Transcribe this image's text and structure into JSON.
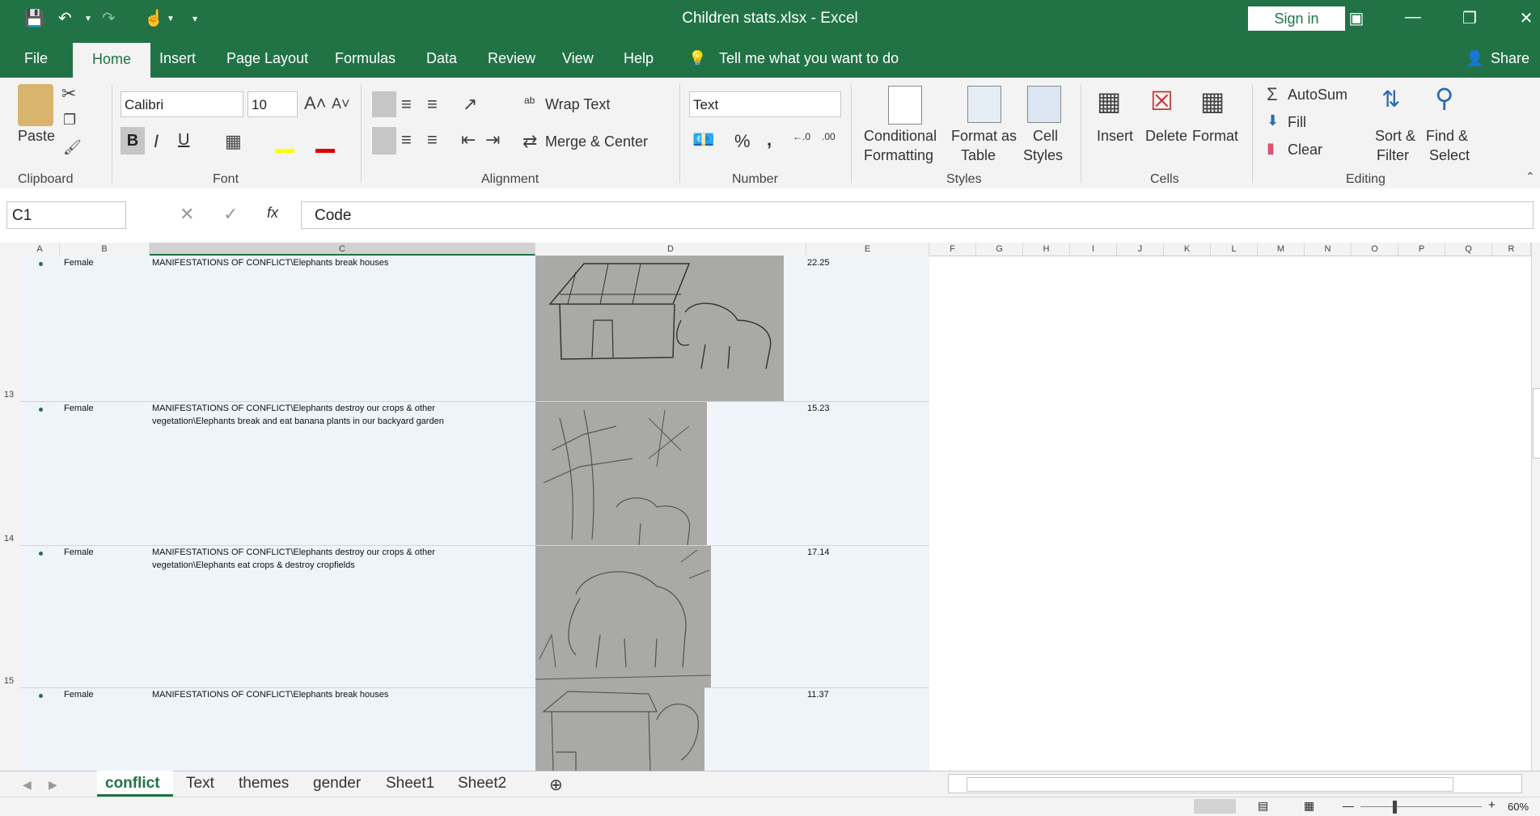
{
  "window": {
    "title": "Children stats.xlsx  -  Excel",
    "sign_in": "Sign in"
  },
  "tabs": [
    "File",
    "Home",
    "Insert",
    "Page Layout",
    "Formulas",
    "Data",
    "Review",
    "View",
    "Help"
  ],
  "tell_me": "Tell me what you want to do",
  "share": "Share",
  "ribbon": {
    "clipboard": {
      "paste": "Paste",
      "label": "Clipboard"
    },
    "font": {
      "name": "Calibri",
      "size": "10",
      "bold": "B",
      "italic": "I",
      "underline": "U",
      "label": "Font"
    },
    "alignment": {
      "wrap_text": "Wrap Text",
      "merge_center": "Merge & Center",
      "label": "Alignment"
    },
    "number": {
      "format": "Text",
      "percent": "%",
      "comma": ",",
      "label": "Number"
    },
    "styles": {
      "conditional": "Conditional",
      "formatting": "Formatting",
      "format_as": "Format as",
      "table": "Table",
      "cell": "Cell",
      "styles_word": "Styles",
      "label": "Styles"
    },
    "cells": {
      "insert": "Insert",
      "delete": "Delete",
      "format": "Format",
      "label": "Cells"
    },
    "editing": {
      "autosum": "AutoSum",
      "fill": "Fill",
      "clear": "Clear",
      "sort": "Sort &",
      "filter": "Filter",
      "find": "Find &",
      "select": "Select",
      "label": "Editing"
    }
  },
  "formula_bar": {
    "name_box": "C1",
    "content": "Code",
    "fx": "fx"
  },
  "columns": [
    "A",
    "B",
    "C",
    "D",
    "E",
    "F",
    "G",
    "H",
    "I",
    "J",
    "K",
    "L",
    "M",
    "N",
    "O",
    "P",
    "Q",
    "R"
  ],
  "rows": [
    {
      "num": "13",
      "gender": "Female",
      "code": "MANIFESTATIONS OF CONFLICT\\Elephants break houses",
      "value": "22.25"
    },
    {
      "num": "14",
      "gender": "Female",
      "code": "MANIFESTATIONS OF CONFLICT\\Elephants destroy our crops & other vegetation\\Elephants break and eat banana plants in our backyard garden",
      "code_line1": "MANIFESTATIONS OF CONFLICT\\Elephants destroy our crops & other",
      "code_line2": "vegetation\\Elephants break and eat banana plants in our backyard garden",
      "value": "15.23"
    },
    {
      "num": "15",
      "gender": "Female",
      "code_line1": "MANIFESTATIONS OF CONFLICT\\Elephants destroy our crops & other",
      "code_line2": "vegetation\\Elephants eat crops & destroy cropfields",
      "value": "17.14"
    },
    {
      "num": "",
      "gender": "Female",
      "code": "MANIFESTATIONS OF CONFLICT\\Elephants break houses",
      "value": "11.37"
    }
  ],
  "sheets": [
    "conflict",
    "Text",
    "themes",
    "gender",
    "Sheet1",
    "Sheet2"
  ],
  "status": {
    "zoom": "60%"
  }
}
